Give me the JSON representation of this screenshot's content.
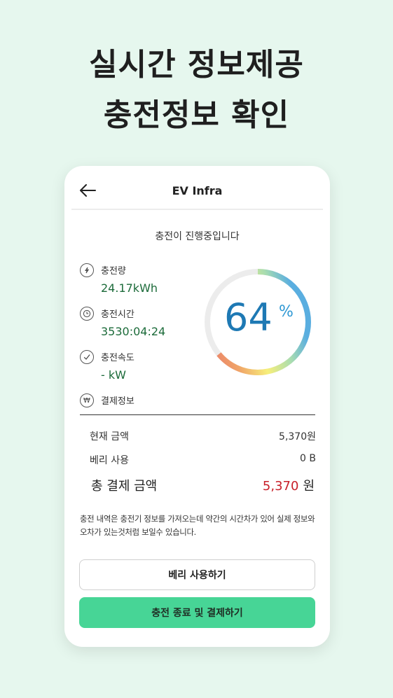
{
  "headline": {
    "line1": "실시간 정보제공",
    "line2": "충전정보 확인"
  },
  "appbar": {
    "back_icon": "back-arrow-icon",
    "title": "EV Infra"
  },
  "status": "충전이 진행중입니다",
  "info": [
    {
      "icon": "charge-amount-icon",
      "label": "충전량",
      "value": "24.17kWh"
    },
    {
      "icon": "clock-icon",
      "label": "충전시간",
      "value": "3530:04:24"
    },
    {
      "icon": "check-circle-icon",
      "label": "충전속도",
      "value": "- kW"
    },
    {
      "icon": "won-icon",
      "label": "결제정보"
    }
  ],
  "progress": {
    "percent": 64,
    "display_value": "64",
    "unit": "%"
  },
  "payment": {
    "current_label": "현재 금액",
    "current_value": "5,370원",
    "berry_label": "베리 사용",
    "berry_value": "0 B",
    "total_label": "총 결제 금액",
    "total_amount": "5,370",
    "total_unit": "원"
  },
  "notice": "충전 내역은 충전기 정보를 가져오는데 약간의 시간차가 있어 실제 정보와 오차가 있는것처럼 보일수 있습니다.",
  "buttons": {
    "use_berry": "베리 사용하기",
    "end_and_pay": "충전 종료 및 결제하기"
  },
  "colors": {
    "background": "#e6f7ee",
    "primary_button": "#47d596",
    "value_green": "#1c6b3a",
    "gauge_number": "#1e79b4",
    "total_red": "#c8202a",
    "gauge_gradient": [
      "#e8746a",
      "#f0a568",
      "#f5e06e",
      "#f7f27a",
      "#a7dcb1",
      "#5aaee0"
    ]
  }
}
